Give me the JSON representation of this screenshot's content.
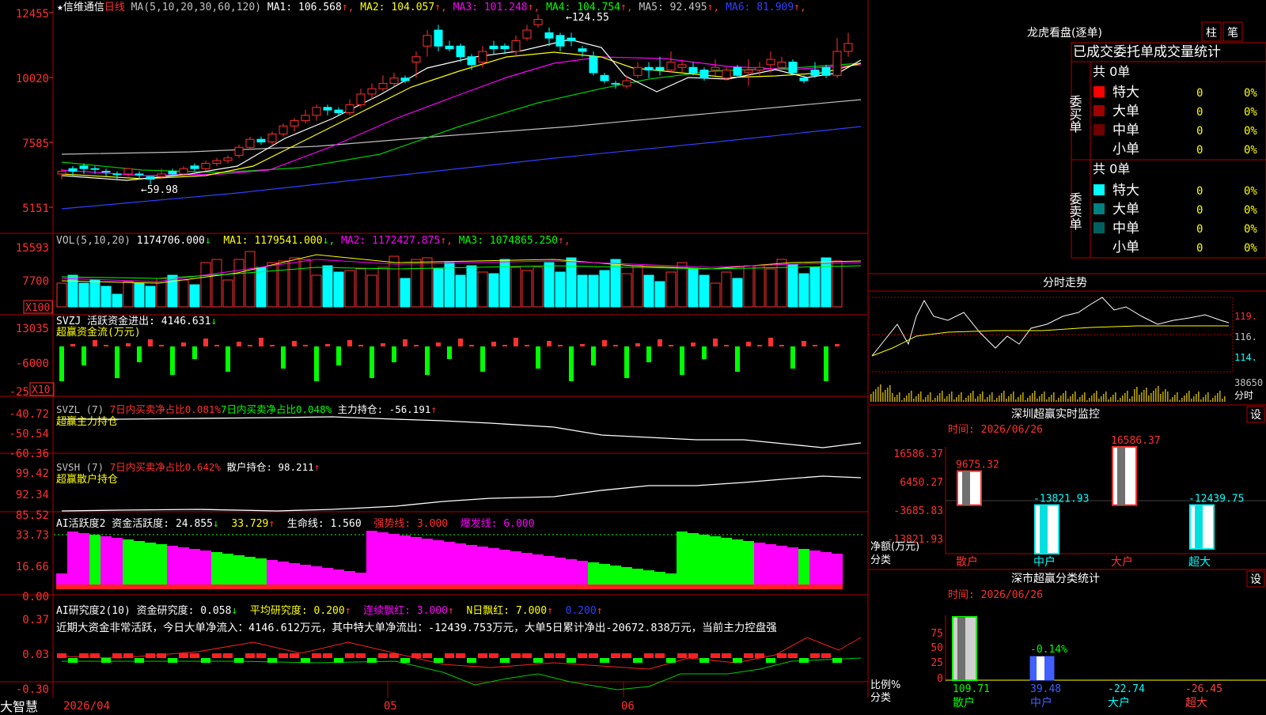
{
  "stock": {
    "name": "★信维通信",
    "period": "日线"
  },
  "ma": {
    "label": "MA(5,10,20,30,60,120)",
    "items": [
      {
        "text": "MA1: 106.568",
        "arrow": "↑",
        "color": "#ffffff"
      },
      {
        "text": "MA2: 104.057",
        "arrow": "↑",
        "color": "#ffff00"
      },
      {
        "text": "MA3: 101.248",
        "arrow": "↑",
        "color": "#ff00ff"
      },
      {
        "text": "MA4: 104.754",
        "arrow": "↑",
        "color": "#00ff00"
      },
      {
        "text": "MA5: 92.495",
        "arrow": "↑",
        "color": "#c0c0c0"
      },
      {
        "text": "MA6: 81.909",
        "arrow": "↑",
        "color": "#3040ff"
      }
    ]
  },
  "price_axis": [
    "12455",
    "10020",
    "7585",
    "5151"
  ],
  "annotations": {
    "high": "124.55",
    "low": "59.98"
  },
  "vol": {
    "label": "VOL(5,10,20)",
    "value": "1174706.000",
    "v_arrow": "↓",
    "items": [
      {
        "text": "MA1: 1179541.000",
        "arrow": "↓",
        "color": "#ffff00"
      },
      {
        "text": "MA2: 1172427.875",
        "arrow": "↑",
        "color": "#ff00ff"
      },
      {
        "text": "MA3: 1074865.250",
        "arrow": "↑",
        "color": "#00ff00"
      }
    ],
    "axis": [
      "15593",
      "7700"
    ],
    "unit": "X100"
  },
  "svzj": {
    "label": "SVZJ  活跃资金进出: 4146.631",
    "arrow": "↓",
    "sub": "超赢资金流(万元)",
    "axis": [
      "13035",
      "-6000",
      "-25"
    ],
    "unit": "X10"
  },
  "svzl": {
    "label": "SVZL (7)",
    "r1": "7日内买卖净占比0.081%",
    "r2": "7日内买卖净占比0.048%",
    "r3": "主力持仓: -56.191",
    "arrow": "↑",
    "sub": "超赢主力持仓",
    "axis": [
      "-40.72",
      "-50.54",
      "-60.36"
    ]
  },
  "svsh": {
    "label": "SVSH (7)",
    "r1": "7日内买卖净占比0.642%",
    "r2": "散户持仓: 98.211",
    "arrow": "↑",
    "sub": "超赢散户持仓",
    "axis": [
      "99.42",
      "92.34",
      "85.52"
    ]
  },
  "ai_act": {
    "label": "AI活跃度2 资金活跃度: 24.855",
    "a1": "↓",
    "v2": "33.729",
    "a2": "↑",
    "v3": "生命线: 1.560",
    "v4": "强势线: 3.000",
    "v5": "爆发线: 6.000",
    "axis": [
      "33.73",
      "16.66",
      "0.00"
    ]
  },
  "ai_res": {
    "label": "AI研究度2(10) 资金研究度: 0.058",
    "a1": "↓",
    "v2": "平均研究度: 0.200",
    "a2": "↑",
    "v3": "连续飘红: 3.000",
    "a3": "↑",
    "v4": "N日飘红: 7.000",
    "a4": "↑",
    "v5": "0.200",
    "a5": "↑",
    "text": "近期大资金非常活跃，今日大单净流入：4146.612万元，其中特大单净流出：-12439.753万元，大单5日累计净出-20672.838万元，当前主力控盘强",
    "axis": [
      "0.37",
      "0.03",
      "-0.30"
    ]
  },
  "date_axis": [
    "2026/04",
    "05",
    "06"
  ],
  "corner": "大智慧",
  "dragon": {
    "title": "龙虎看盘(逐单)",
    "btn1": "柱",
    "btn2": "笔",
    "tabs": "已成交委托单成交量统计",
    "buy": {
      "side": "委买单",
      "total": "共 0单",
      "rows": [
        {
          "name": "特大",
          "v": "0",
          "p": "0%",
          "color": "#ff0000"
        },
        {
          "name": "大单",
          "v": "0",
          "p": "0%",
          "color": "#a00000"
        },
        {
          "name": "中单",
          "v": "0",
          "p": "0%",
          "color": "#700000"
        },
        {
          "name": "小单",
          "v": "0",
          "p": "0%",
          "color": ""
        }
      ]
    },
    "sell": {
      "side": "委卖单",
      "total": "共 0单",
      "rows": [
        {
          "name": "特大",
          "v": "0",
          "p": "0%",
          "color": "#00ffff"
        },
        {
          "name": "大单",
          "v": "0",
          "p": "0%",
          "color": "#008080"
        },
        {
          "name": "中单",
          "v": "0",
          "p": "0%",
          "color": "#006060"
        },
        {
          "name": "小单",
          "v": "0",
          "p": "0%",
          "color": ""
        }
      ]
    }
  },
  "minute": {
    "title": "分时走势",
    "axis": [
      "119.",
      "116.",
      "114.",
      "38650"
    ],
    "unit": "分时"
  },
  "sz_monitor": {
    "title": "深圳超赢实时监控",
    "btn": "设",
    "date": "时间: 2026/06/26",
    "axis": [
      "16586.37",
      "6450.27",
      "-3685.83",
      "-13821.93"
    ],
    "ylabel": "净额(万元)",
    "xlabel": "分类",
    "chart_data": {
      "type": "bar",
      "categories": [
        "散户",
        "中户",
        "大户",
        "超大"
      ],
      "values": [
        9675.32,
        -13821.93,
        16586.37,
        -12439.75
      ],
      "labels": [
        "9675.32",
        "-13821.93",
        "16586.37",
        "-12439.75"
      ],
      "ylim": [
        -13821.93,
        16586.37
      ]
    }
  },
  "sz_class": {
    "title": "深市超赢分类统计",
    "btn": "设",
    "date": "时间: 2026/06/26",
    "ylabel": "比例%",
    "xlabel": "分类",
    "chart_data": {
      "type": "bar",
      "categories": [
        "散户",
        "中户",
        "大户",
        "超大"
      ],
      "y_ticks": [
        "75",
        "50",
        "25",
        "0"
      ],
      "bar_values": [
        100,
        -0.14,
        0,
        0
      ],
      "bar_labels": [
        "",
        "-0.14%",
        "",
        ""
      ],
      "values": [
        "109.71",
        "39.48",
        "-22.74",
        "-26.45"
      ],
      "value_colors": [
        "#00ff00",
        "#4060ff",
        "#00ffff",
        "#ff4040"
      ]
    }
  },
  "chart_data": {
    "type": "candlestick",
    "dates": [
      "2026/04",
      "05",
      "06"
    ],
    "candles": [
      [
        64,
        65,
        62,
        66,
        1
      ],
      [
        65,
        66,
        63,
        67,
        -1
      ],
      [
        66,
        67,
        64,
        68,
        -1
      ],
      [
        66,
        66,
        64,
        67,
        -1
      ],
      [
        65,
        65,
        63,
        66,
        -1
      ],
      [
        64,
        64,
        62,
        65,
        -1
      ],
      [
        64,
        66,
        63,
        66,
        1
      ],
      [
        64,
        64,
        62,
        65,
        -1
      ],
      [
        63,
        62,
        60,
        63,
        -1
      ],
      [
        63,
        64,
        62,
        66,
        1
      ],
      [
        64,
        65,
        63,
        66,
        -1
      ],
      [
        64,
        66,
        63,
        67,
        1
      ],
      [
        66,
        67,
        65,
        68,
        -1
      ],
      [
        66,
        68,
        65,
        69,
        1
      ],
      [
        68,
        69,
        67,
        70,
        1
      ],
      [
        69,
        70,
        68,
        71,
        1
      ],
      [
        71,
        74,
        70,
        75,
        1
      ],
      [
        74,
        77,
        73,
        78,
        1
      ],
      [
        77,
        76,
        75,
        78,
        -1
      ],
      [
        76,
        79,
        75,
        80,
        1
      ],
      [
        79,
        82,
        78,
        83,
        1
      ],
      [
        82,
        84,
        80,
        85,
        1
      ],
      [
        84,
        86,
        83,
        88,
        1
      ],
      [
        86,
        89,
        84,
        90,
        1
      ],
      [
        89,
        88,
        86,
        90,
        -1
      ],
      [
        88,
        87,
        86,
        89,
        -1
      ],
      [
        87,
        90,
        86,
        92,
        1
      ],
      [
        90,
        94,
        89,
        96,
        1
      ],
      [
        94,
        96,
        92,
        98,
        1
      ],
      [
        96,
        98,
        95,
        101,
        1
      ],
      [
        98,
        100,
        97,
        102,
        1
      ],
      [
        100,
        99,
        98,
        101,
        -1
      ],
      [
        106,
        108,
        100,
        110,
        1
      ],
      [
        112,
        116,
        108,
        118,
        1
      ],
      [
        118,
        112,
        110,
        120,
        -1
      ],
      [
        112,
        111,
        110,
        114,
        -1
      ],
      [
        112,
        108,
        106,
        113,
        -1
      ],
      [
        108,
        105,
        103,
        109,
        -1
      ],
      [
        106,
        110,
        104,
        112,
        1
      ],
      [
        111,
        112,
        109,
        114,
        -1
      ],
      [
        112,
        111,
        109,
        113,
        -1
      ],
      [
        110,
        114,
        108,
        116,
        1
      ],
      [
        115,
        118,
        114,
        120,
        1
      ],
      [
        120,
        122,
        119,
        124,
        1
      ],
      [
        117,
        115,
        112,
        119,
        -1
      ],
      [
        116,
        112,
        110,
        117,
        -1
      ],
      [
        115,
        114,
        112,
        117,
        -1
      ],
      [
        111,
        110,
        108,
        112,
        -1
      ],
      [
        108,
        102,
        101,
        110,
        -1
      ],
      [
        101,
        99,
        98,
        102,
        -1
      ],
      [
        98,
        98,
        96,
        99,
        -1
      ],
      [
        97,
        99,
        96,
        101,
        1
      ],
      [
        101,
        104,
        100,
        106,
        1
      ],
      [
        104,
        103,
        100,
        106,
        -1
      ],
      [
        104,
        103,
        101,
        108,
        -1
      ],
      [
        103,
        106,
        102,
        110,
        1
      ],
      [
        104,
        105,
        102,
        107,
        1
      ],
      [
        104,
        102,
        101,
        106,
        -1
      ],
      [
        103,
        100,
        99,
        104,
        -1
      ],
      [
        103,
        104,
        101,
        107,
        1
      ],
      [
        100,
        103,
        99,
        104,
        1
      ],
      [
        104,
        101,
        100,
        105,
        -1
      ],
      [
        102,
        103,
        97,
        107,
        1
      ],
      [
        103,
        104,
        101,
        106,
        1
      ],
      [
        105,
        107,
        102,
        110,
        1
      ],
      [
        104,
        106,
        103,
        108,
        1
      ],
      [
        106,
        102,
        101,
        107,
        -1
      ],
      [
        99,
        100,
        98,
        101,
        -1
      ],
      [
        103,
        101,
        100,
        106,
        -1
      ],
      [
        104,
        101,
        100,
        105,
        -1
      ],
      [
        101,
        110,
        100,
        115,
        1
      ],
      [
        110,
        113,
        108,
        117,
        1
      ]
    ],
    "high_label": "124.55",
    "low_label": "59.98"
  }
}
